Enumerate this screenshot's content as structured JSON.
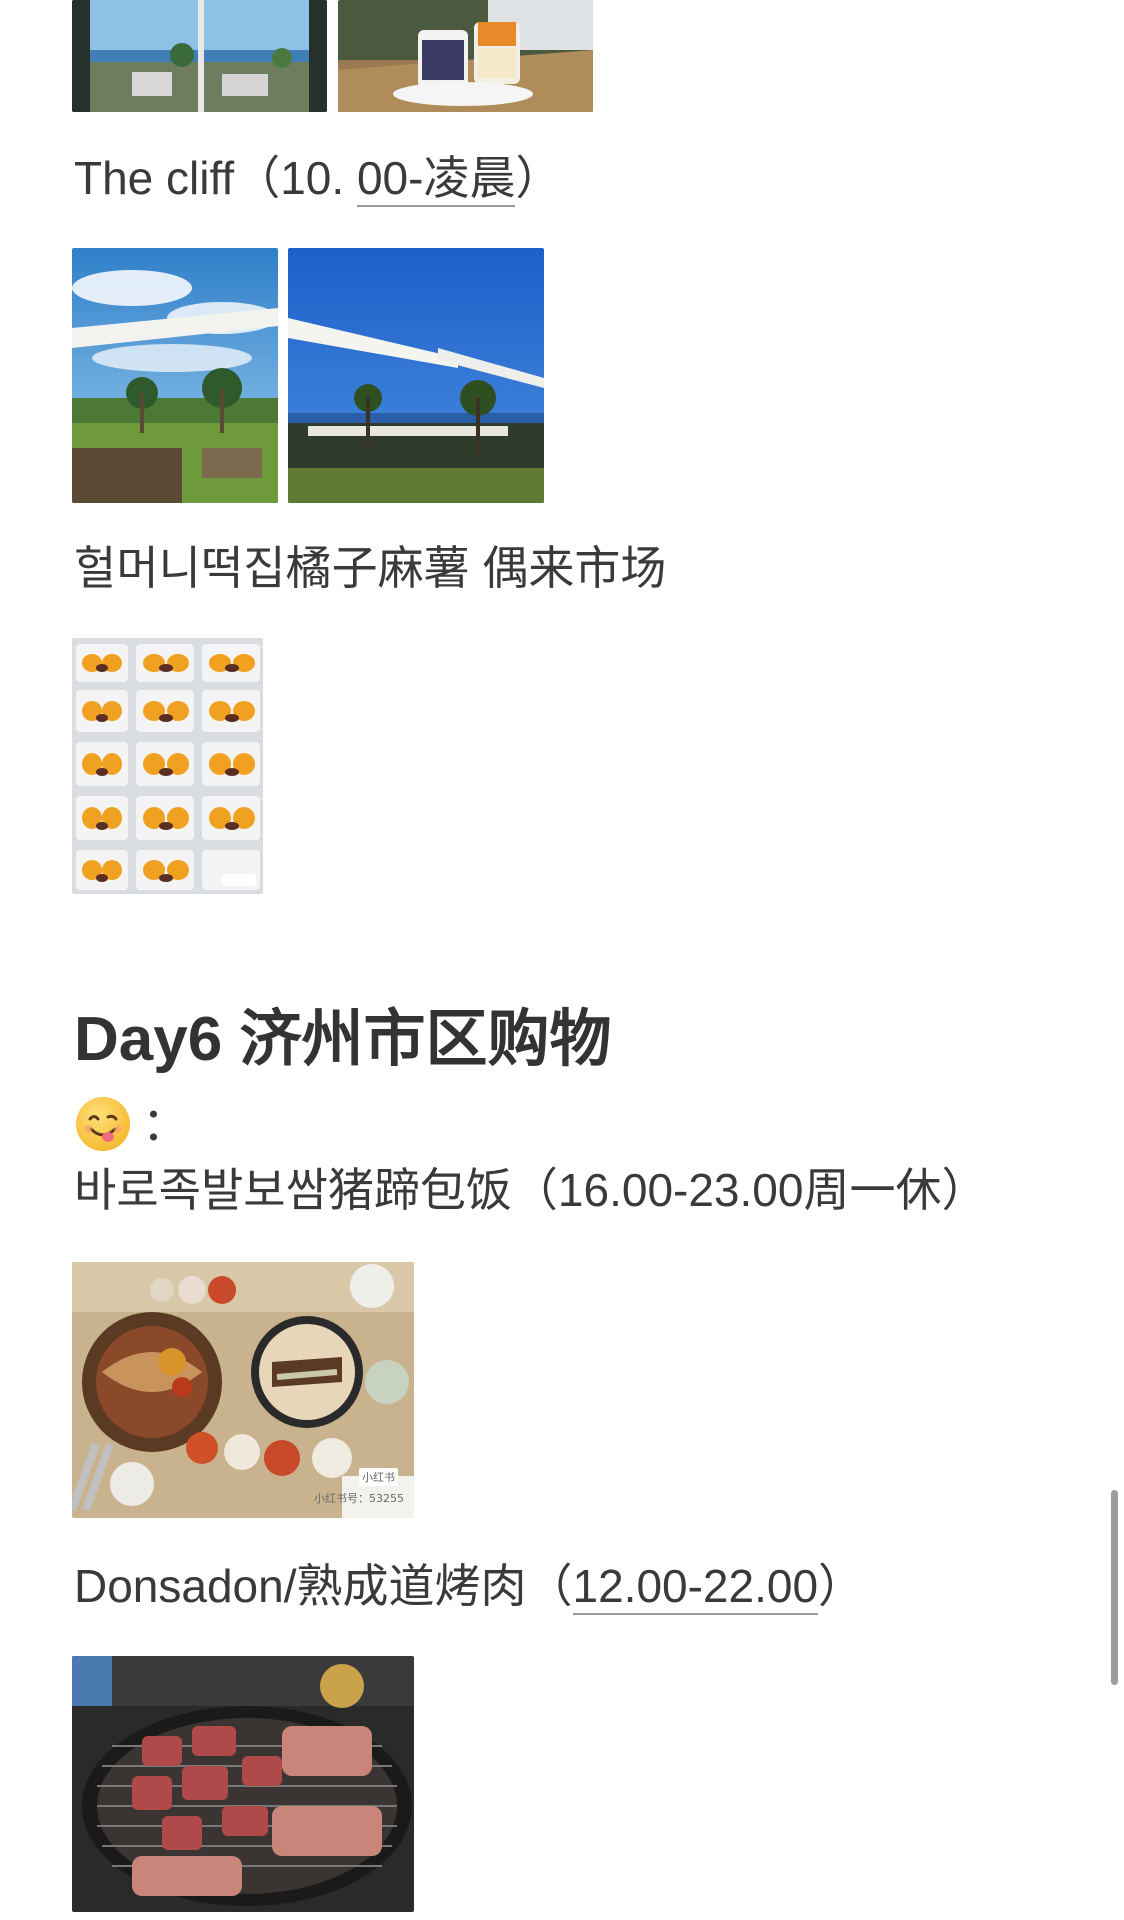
{
  "sections": {
    "the_cliff": {
      "name": "The cliff",
      "hours_prefix": "（10. ",
      "hours_underlined": "00-凌晨",
      "hours_suffix": "）"
    },
    "market_item": {
      "label": "헐머니떡집橘子麻薯 偶来市场"
    }
  },
  "day6": {
    "title": "Day6 济州市区购物",
    "emoji_icon": "yum-face-emoji",
    "emoji_colon": "：",
    "restaurant_1": {
      "label": "바로족발보쌈猪蹄包饭（16.00-23.00周一休）"
    },
    "restaurant_2": {
      "name": "Donsadon/熟成道烤肉（",
      "hours_underlined": "12.00-22.00",
      "suffix": "）"
    }
  },
  "watermark": {
    "brand": "小红书",
    "id_prefix": "小红书号：53255"
  },
  "colors": {
    "text": "#3a3a3a",
    "heading": "#333333",
    "scrollbar": "#9d9d9d",
    "background": "#ffffff"
  }
}
